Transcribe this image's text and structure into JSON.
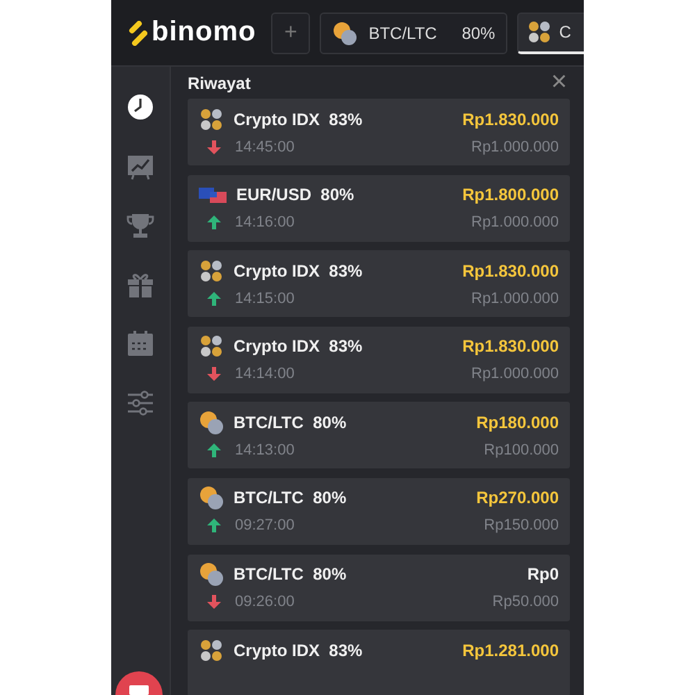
{
  "header": {
    "logo": "binomo",
    "tabs": [
      {
        "kind": "add",
        "label": "+",
        "selected": false
      },
      {
        "kind": "btc_ltc",
        "label": "BTC/LTC",
        "payout": "80%",
        "selected": false
      },
      {
        "kind": "crypto_idx",
        "label": "C",
        "selected": true
      }
    ]
  },
  "sidebar": {
    "items": [
      {
        "kind": "clock",
        "selected": true
      },
      {
        "kind": "chart",
        "selected": false
      },
      {
        "kind": "trophy",
        "selected": false
      },
      {
        "kind": "gift",
        "selected": false
      },
      {
        "kind": "calendar",
        "selected": false
      },
      {
        "kind": "sliders",
        "selected": false
      }
    ]
  },
  "panel": {
    "title": "Riwayat",
    "close": "×",
    "trades": [
      {
        "kind": "crypto_idx",
        "name": "Crypto IDX",
        "payout": "83%",
        "up": false,
        "time": "14:45:00",
        "result": "Rp1.830.000",
        "won": true,
        "stake": "Rp1.000.000"
      },
      {
        "kind": "eur_usd",
        "name": "EUR/USD",
        "payout": "80%",
        "up": true,
        "time": "14:16:00",
        "result": "Rp1.800.000",
        "won": true,
        "stake": "Rp1.000.000"
      },
      {
        "kind": "crypto_idx",
        "name": "Crypto IDX",
        "payout": "83%",
        "up": true,
        "time": "14:15:00",
        "result": "Rp1.830.000",
        "won": true,
        "stake": "Rp1.000.000"
      },
      {
        "kind": "crypto_idx",
        "name": "Crypto IDX",
        "payout": "83%",
        "up": false,
        "time": "14:14:00",
        "result": "Rp1.830.000",
        "won": true,
        "stake": "Rp1.000.000"
      },
      {
        "kind": "btc_ltc",
        "name": "BTC/LTC",
        "payout": "80%",
        "up": true,
        "time": "14:13:00",
        "result": "Rp180.000",
        "won": true,
        "stake": "Rp100.000"
      },
      {
        "kind": "btc_ltc",
        "name": "BTC/LTC",
        "payout": "80%",
        "up": true,
        "time": "09:27:00",
        "result": "Rp270.000",
        "won": true,
        "stake": "Rp150.000"
      },
      {
        "kind": "btc_ltc",
        "name": "BTC/LTC",
        "payout": "80%",
        "up": false,
        "time": "09:26:00",
        "result": "Rp0",
        "won": false,
        "stake": "Rp50.000"
      },
      {
        "kind": "crypto_idx",
        "name": "Crypto IDX",
        "payout": "83%",
        "result": "Rp1.281.000",
        "won": true
      }
    ]
  }
}
